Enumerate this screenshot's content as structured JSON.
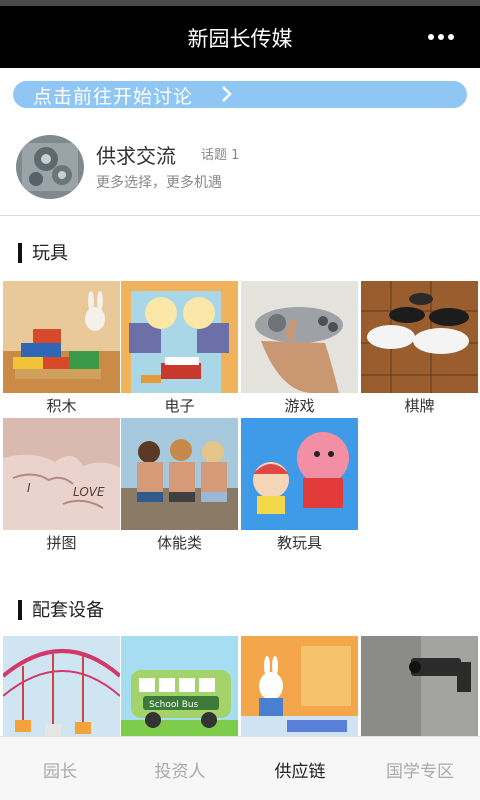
{
  "app": {
    "title": "新园长传媒"
  },
  "discussion": {
    "label": "点击前往开始讨论"
  },
  "group": {
    "name": "供求交流",
    "topics": "话题 1",
    "desc": "更多选择，更多机遇"
  },
  "sections": [
    {
      "title": "玩具",
      "items": [
        "积木",
        "电子",
        "游戏",
        "棋牌",
        "拼图",
        "体能类",
        "教玩具"
      ]
    },
    {
      "title": "配套设备"
    }
  ],
  "tabs": [
    "园长",
    "投资人",
    "供应链",
    "国学专区"
  ],
  "active_tab": "供应链",
  "colors": {
    "header": "#000000",
    "accent_pill": "#8fc6f4",
    "tab_active": "#222222",
    "tab_inactive": "#aaaaaa"
  }
}
